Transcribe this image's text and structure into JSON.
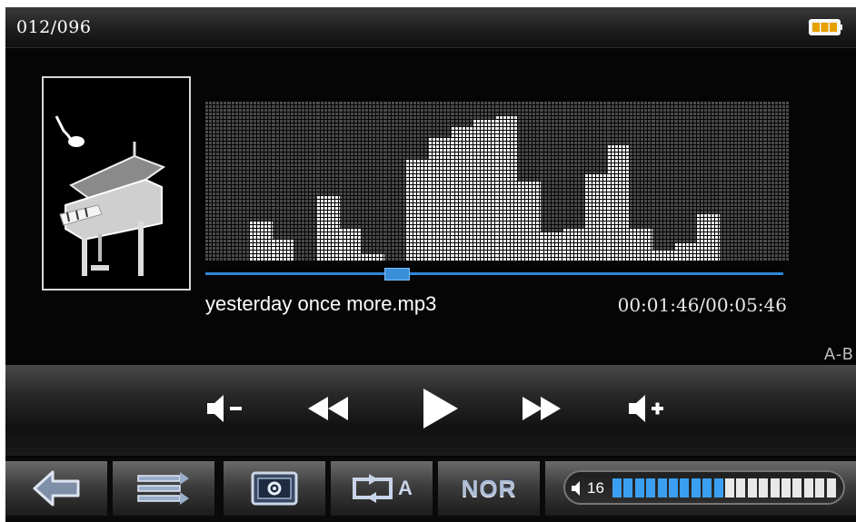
{
  "status_bar": {
    "track_counter": "012/096",
    "battery_icon": "battery-full-icon"
  },
  "now_playing": {
    "album_art_icon": "piano-music-note-icon",
    "song_title": "yesterday once more.mp3",
    "time_display": "00:01:46/00:05:46",
    "progress_fraction": 0.33,
    "ab_label": "A-B"
  },
  "spectrum_levels": [
    0,
    0,
    0.24,
    0.14,
    0,
    0.4,
    0.2,
    0.05,
    0,
    0.63,
    0.77,
    0.85,
    0.89,
    0.92,
    0.51,
    0.18,
    0.2,
    0.55,
    0.72,
    0.2,
    0.06,
    0.11,
    0.29,
    0,
    0,
    0
  ],
  "controls": {
    "volume_down_icon": "volume-down-icon",
    "rewind_icon": "rewind-icon",
    "play_icon": "play-icon",
    "fast_forward_icon": "fast-forward-icon",
    "volume_up_icon": "volume-up-icon"
  },
  "toolbar": {
    "back_icon": "back-arrow-icon",
    "playlist_icon": "playlist-icon",
    "settings_icon": "screen-settings-icon",
    "repeat_icon": "repeat-icon",
    "repeat_label": "A",
    "eq_label": "NOR",
    "volume_icon": "speaker-icon",
    "volume_level": "16",
    "volume_segments_total": 20,
    "volume_segments_active": 10
  },
  "colors": {
    "accent_blue": "#2f86d8",
    "volume_active": "#3a9ff0",
    "volume_inactive": "#e8e8e8"
  }
}
